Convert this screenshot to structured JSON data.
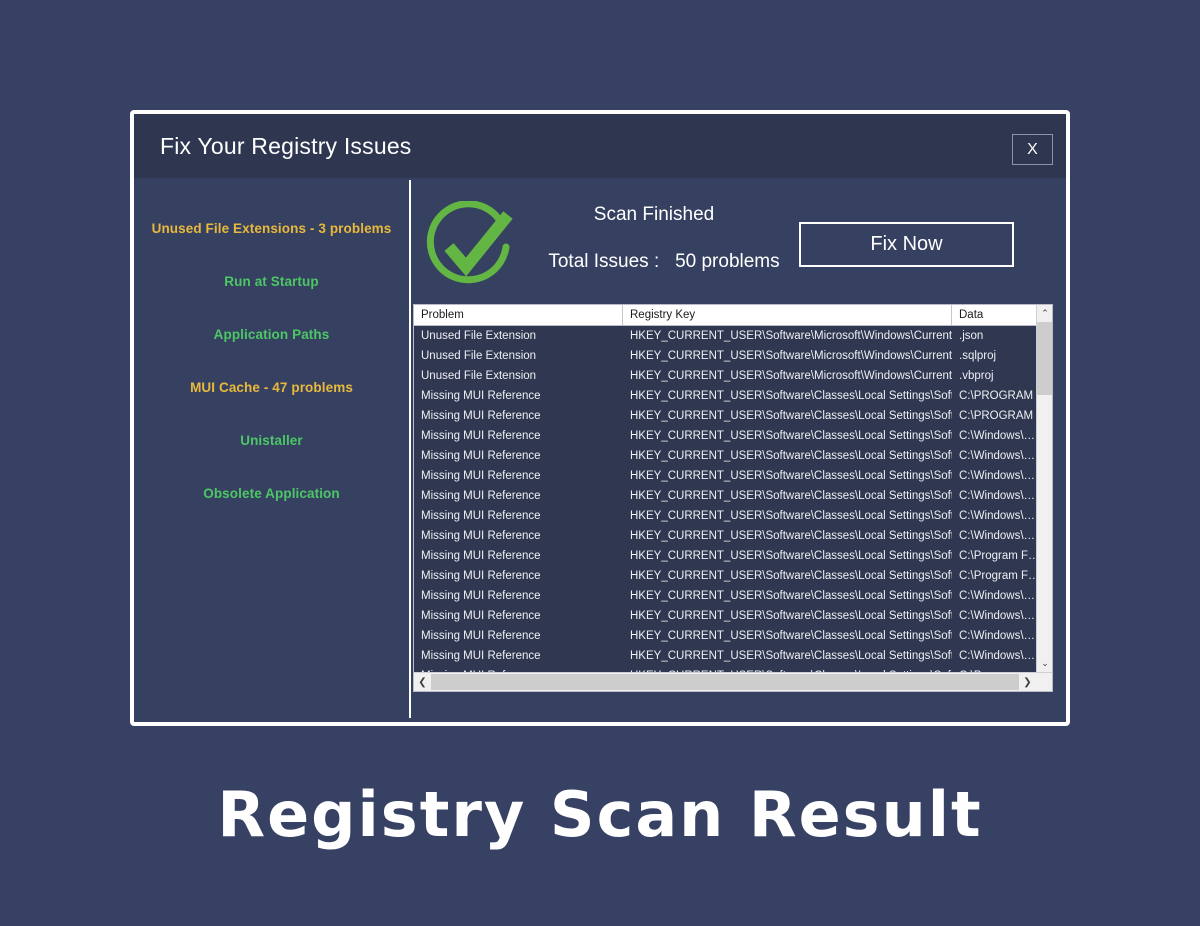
{
  "window": {
    "title": "Fix Your Registry Issues",
    "close_label": "X"
  },
  "sidebar": {
    "items": [
      {
        "label": "Unused File Extensions - 3 problems",
        "color": "#e8b93c"
      },
      {
        "label": "Run at Startup",
        "color": "#4cc766"
      },
      {
        "label": "Application Paths",
        "color": "#4cc766"
      },
      {
        "label": "MUI Cache - 47 problems",
        "color": "#e8b93c"
      },
      {
        "label": "Unistaller",
        "color": "#4cc766"
      },
      {
        "label": "Obsolete Application",
        "color": "#4cc766"
      }
    ]
  },
  "status": {
    "icon": "check-circle-icon",
    "icon_color": "#63b544",
    "scan_state": "Scan Finished",
    "total_label": "Total Issues :",
    "total_value": "50 problems",
    "fix_button": "Fix Now"
  },
  "table": {
    "columns": [
      "Problem",
      "Registry Key",
      "Data"
    ],
    "rows": [
      {
        "problem": "Unused File Extension",
        "key": "HKEY_CURRENT_USER\\Software\\Microsoft\\Windows\\Current…",
        "data": ".json"
      },
      {
        "problem": "Unused File Extension",
        "key": "HKEY_CURRENT_USER\\Software\\Microsoft\\Windows\\Current…",
        "data": ".sqlproj"
      },
      {
        "problem": "Unused File Extension",
        "key": "HKEY_CURRENT_USER\\Software\\Microsoft\\Windows\\Current…",
        "data": ".vbproj"
      },
      {
        "problem": "Missing MUI Reference",
        "key": "HKEY_CURRENT_USER\\Software\\Classes\\Local Settings\\Softw…",
        "data": "C:\\PROGRAM …"
      },
      {
        "problem": "Missing MUI Reference",
        "key": "HKEY_CURRENT_USER\\Software\\Classes\\Local Settings\\Softw…",
        "data": "C:\\PROGRAM …"
      },
      {
        "problem": "Missing MUI Reference",
        "key": "HKEY_CURRENT_USER\\Software\\Classes\\Local Settings\\Softw…",
        "data": "C:\\Windows\\…"
      },
      {
        "problem": "Missing MUI Reference",
        "key": "HKEY_CURRENT_USER\\Software\\Classes\\Local Settings\\Softw…",
        "data": "C:\\Windows\\…"
      },
      {
        "problem": "Missing MUI Reference",
        "key": "HKEY_CURRENT_USER\\Software\\Classes\\Local Settings\\Softw…",
        "data": "C:\\Windows\\…"
      },
      {
        "problem": "Missing MUI Reference",
        "key": "HKEY_CURRENT_USER\\Software\\Classes\\Local Settings\\Softw…",
        "data": "C:\\Windows\\…"
      },
      {
        "problem": "Missing MUI Reference",
        "key": "HKEY_CURRENT_USER\\Software\\Classes\\Local Settings\\Softw…",
        "data": "C:\\Windows\\…"
      },
      {
        "problem": "Missing MUI Reference",
        "key": "HKEY_CURRENT_USER\\Software\\Classes\\Local Settings\\Softw…",
        "data": "C:\\Windows\\…"
      },
      {
        "problem": "Missing MUI Reference",
        "key": "HKEY_CURRENT_USER\\Software\\Classes\\Local Settings\\Softw…",
        "data": "C:\\Program F…"
      },
      {
        "problem": "Missing MUI Reference",
        "key": "HKEY_CURRENT_USER\\Software\\Classes\\Local Settings\\Softw…",
        "data": "C:\\Program F…"
      },
      {
        "problem": "Missing MUI Reference",
        "key": "HKEY_CURRENT_USER\\Software\\Classes\\Local Settings\\Softw…",
        "data": "C:\\Windows\\…"
      },
      {
        "problem": "Missing MUI Reference",
        "key": "HKEY_CURRENT_USER\\Software\\Classes\\Local Settings\\Softw…",
        "data": "C:\\Windows\\…"
      },
      {
        "problem": "Missing MUI Reference",
        "key": "HKEY_CURRENT_USER\\Software\\Classes\\Local Settings\\Softw…",
        "data": "C:\\Windows\\…"
      },
      {
        "problem": "Missing MUI Reference",
        "key": "HKEY_CURRENT_USER\\Software\\Classes\\Local Settings\\Softw…",
        "data": "C:\\Windows\\…"
      },
      {
        "problem": "Missing MUI Reference",
        "key": "HKEY_CURRENT_USER\\Software\\Classes\\Local Settings\\Softw…",
        "data": "C:\\Program …"
      }
    ],
    "scroll_up": "⌃",
    "scroll_down": "⌄",
    "scroll_left": "❮",
    "scroll_right": "❯"
  },
  "caption": "Registry Scan Result",
  "theme": {
    "page_bg": "#374163",
    "window_bg": "#364060",
    "titlebar_bg": "#2e3650",
    "accent_green": "#4cc766",
    "accent_yellow": "#e8b93c",
    "check_green": "#63b544"
  }
}
